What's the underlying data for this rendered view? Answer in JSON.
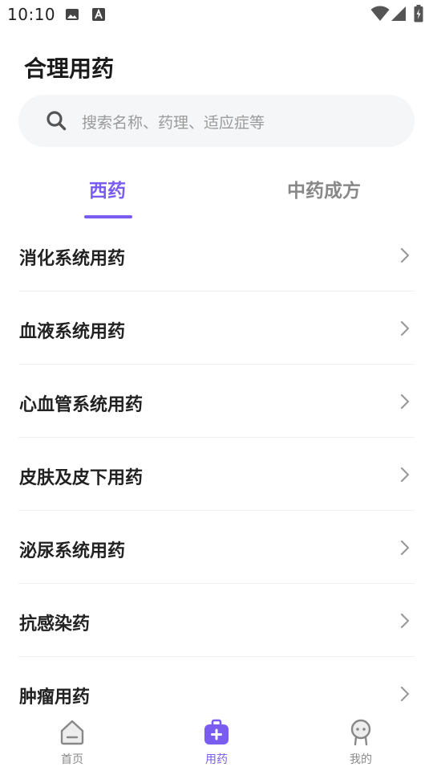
{
  "status_bar": {
    "time": "10:10",
    "icons": [
      "image-icon",
      "font-icon",
      "wifi-icon",
      "signal-icon",
      "battery-charging-icon"
    ]
  },
  "header": {
    "title": "合理用药"
  },
  "search": {
    "placeholder": "搜索名称、药理、适应症等",
    "icon": "search-icon"
  },
  "tabs": [
    {
      "label": "西药",
      "active": true
    },
    {
      "label": "中药成方",
      "active": false
    }
  ],
  "categories": [
    {
      "label": "消化系统用药"
    },
    {
      "label": "血液系统用药"
    },
    {
      "label": "心血管系统用药"
    },
    {
      "label": "皮肤及皮下用药"
    },
    {
      "label": "泌尿系统用药"
    },
    {
      "label": "抗感染药"
    },
    {
      "label": "肿瘤用药"
    }
  ],
  "bottom_nav": [
    {
      "label": "首页",
      "icon": "home-icon",
      "active": false
    },
    {
      "label": "用药",
      "icon": "medicine-kit-icon",
      "active": true
    },
    {
      "label": "我的",
      "icon": "profile-icon",
      "active": false
    }
  ],
  "colors": {
    "accent": "#7a5cf0",
    "inactive": "#8a8a8a",
    "search_bg": "#f5f6f8"
  }
}
